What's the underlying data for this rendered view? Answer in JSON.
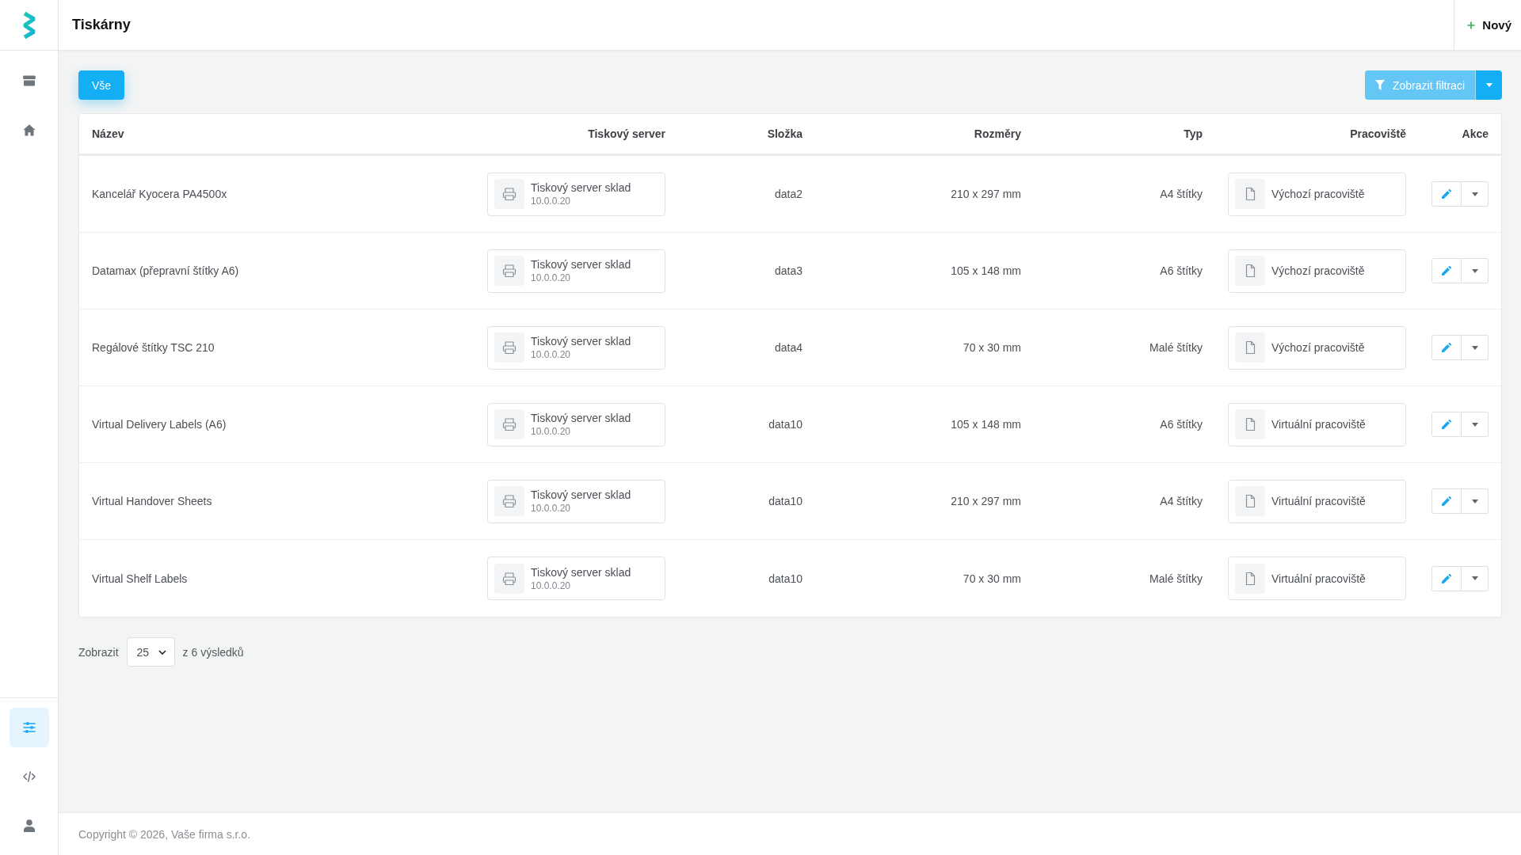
{
  "sidebar": {
    "top_items": [
      {
        "kind": "store",
        "selected": false
      },
      {
        "kind": "home",
        "selected": false
      }
    ],
    "bottom_items": [
      {
        "kind": "sliders",
        "selected": true
      },
      {
        "kind": "code",
        "selected": false
      },
      {
        "kind": "user",
        "selected": false
      }
    ]
  },
  "header": {
    "title": "Tiskárny",
    "new_button": "Nový"
  },
  "toolbar": {
    "tabs": [
      {
        "label": "Vše",
        "selected": true
      }
    ],
    "filter_button": "Zobrazit filtraci"
  },
  "table": {
    "columns": [
      "Název",
      "Tiskový server",
      "Složka",
      "Rozměry",
      "Typ",
      "Pracoviště",
      "Akce"
    ],
    "rows": [
      {
        "name": "Kancelář Kyocera PA4500x",
        "server": {
          "name": "Tiskový server sklad",
          "address": "10.0.0.20"
        },
        "folder": "data2",
        "dimensions": "210 x 297 mm",
        "type": "A4 štítky",
        "workplace": "Výchozí pracoviště"
      },
      {
        "name": "Datamax (přepravní štítky A6)",
        "server": {
          "name": "Tiskový server sklad",
          "address": "10.0.0.20"
        },
        "folder": "data3",
        "dimensions": "105 x 148 mm",
        "type": "A6 štítky",
        "workplace": "Výchozí pracoviště"
      },
      {
        "name": "Regálové štítky TSC 210",
        "server": {
          "name": "Tiskový server sklad",
          "address": "10.0.0.20"
        },
        "folder": "data4",
        "dimensions": "70 x 30 mm",
        "type": "Malé štítky",
        "workplace": "Výchozí pracoviště"
      },
      {
        "name": "Virtual Delivery Labels (A6)",
        "server": {
          "name": "Tiskový server sklad",
          "address": "10.0.0.20"
        },
        "folder": "data10",
        "dimensions": "105 x 148 mm",
        "type": "A6 štítky",
        "workplace": "Virtuální pracoviště"
      },
      {
        "name": "Virtual Handover Sheets",
        "server": {
          "name": "Tiskový server sklad",
          "address": "10.0.0.20"
        },
        "folder": "data10",
        "dimensions": "210 x 297 mm",
        "type": "A4 štítky",
        "workplace": "Virtuální pracoviště"
      },
      {
        "name": "Virtual Shelf Labels",
        "server": {
          "name": "Tiskový server sklad",
          "address": "10.0.0.20"
        },
        "folder": "data10",
        "dimensions": "70 x 30 mm",
        "type": "Malé štítky",
        "workplace": "Virtuální pracoviště"
      }
    ]
  },
  "pagination": {
    "label": "Zobrazit",
    "page_size": "25",
    "summary": "z 6 výsledků"
  },
  "footer": {
    "copyright": "Copyright © 2026, Vaše firma s.r.o."
  }
}
